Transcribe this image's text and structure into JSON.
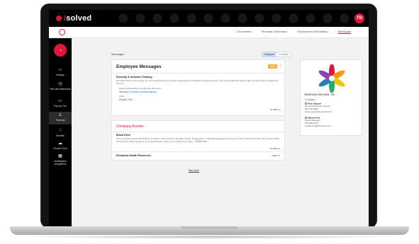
{
  "app": {
    "brand_prefix": "i",
    "brand_name": "solved",
    "avatar_initials": "TB"
  },
  "nav_tabs": [
    "Documents",
    "Personal Information",
    "Employment Information",
    "Messages"
  ],
  "active_tab": "Messages",
  "sidebar": {
    "items": [
      {
        "label": "Manage",
        "icon": "briefcase-icon"
      },
      {
        "label": "Time and Attendance",
        "icon": "clock-icon"
      },
      {
        "label": "Pay and Tax",
        "icon": "money-icon"
      },
      {
        "label": "Personal",
        "icon": "person-icon"
      },
      {
        "label": "Benefits",
        "icon": "shield-icon"
      },
      {
        "label": "People Cloud",
        "icon": "cloud-icon"
      },
      {
        "label": "Marketplace Integrations",
        "icon": "grid-icon"
      }
    ],
    "active": "Personal"
  },
  "page": {
    "breadcrumb": "Messages",
    "toggle": [
      "Employee",
      "Company"
    ],
    "toggle_active": "Employee"
  },
  "employee_messages": {
    "title": "Employee Messages",
    "new_badge": "NEW",
    "count": "1",
    "item_title": "Diversity & Inclusion Training",
    "item_body": "Reminder that we are hosting our upcoming Diversity & Inclusion training that is mandatory for all employees. The training will take place at 3pm on June 21st in Conference Room A.",
    "ack_text": "Please acknowledge the following document:",
    "ack_link": "Diversity & Inclusion Training Agenda",
    "links_label": "Links:",
    "link": "Register here",
    "close": "CLOSE"
  },
  "company_events": {
    "title": "Company Events",
    "event1_title": "Blood Drive",
    "event1_body": "Just a reminder that the Blood Drive is TODAY until 3:00 PM in the Main Center, Training Room. Wait will be available during the 11:30 to 12:30 and 2:30-2:30 windows ONLY for those who have signed up for an appointment, thank you for signing your appo...",
    "read_more": "Read more",
    "close": "CLOSE",
    "event2_title": "Emotional Health Resources",
    "view": "VIEW"
  },
  "see_more": "See more",
  "company": {
    "name": "Business Services, Inc.",
    "contacts_label": "Contacts",
    "contacts": [
      {
        "name": "Peter Nguyen",
        "role": "Human Resources Director",
        "phone": "205-375-4658",
        "email": "peter.nguyen@hrvendor.com"
      },
      {
        "name": "Wanda Pratt",
        "role": "Payroll Manager",
        "phone": "205-289-6120",
        "email": "wanda.pratt@hrvendor.com"
      }
    ]
  },
  "colors": {
    "accent": "#e3143c",
    "link": "#2b6fc9",
    "badge": "#f4b43a"
  }
}
